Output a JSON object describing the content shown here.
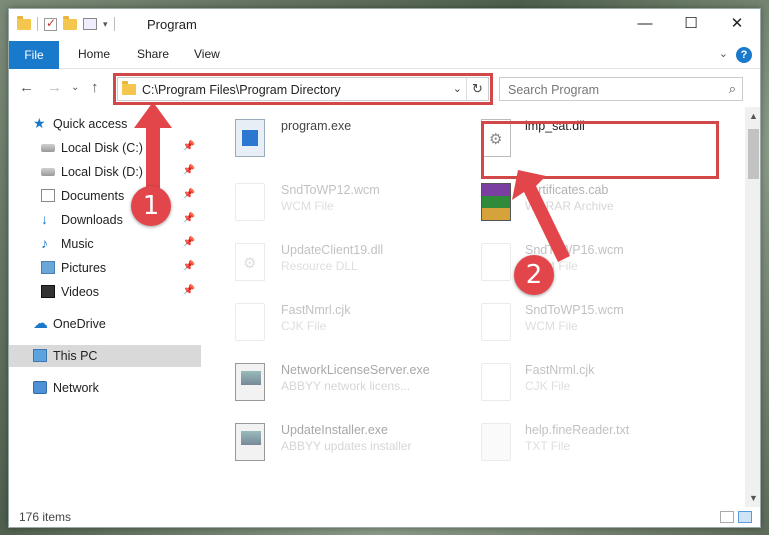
{
  "window": {
    "title": "Program",
    "minimize": "—",
    "maximize": "☐",
    "close": "✕"
  },
  "ribbon": {
    "tabs": [
      "File",
      "Home",
      "Share",
      "View"
    ],
    "help": "?",
    "collapse": "⌄"
  },
  "nav": {
    "back": "←",
    "forward": "→",
    "recent": "⌄",
    "up": "↑",
    "address": "C:\\Program Files\\Program Directory",
    "address_dropdown": "⌄",
    "refresh": "↻",
    "search_placeholder": "Search Program",
    "search_icon": "⌕"
  },
  "sidebar": {
    "items": [
      {
        "label": "Quick access",
        "icon": "star-icon",
        "pinned": false
      },
      {
        "label": "Local Disk (C:)",
        "icon": "drive-icon",
        "pinned": true
      },
      {
        "label": "Local Disk (D:)",
        "icon": "drive-icon",
        "pinned": true
      },
      {
        "label": "Documents",
        "icon": "documents-icon",
        "pinned": true
      },
      {
        "label": "Downloads",
        "icon": "download-icon",
        "pinned": true
      },
      {
        "label": "Music",
        "icon": "music-icon",
        "pinned": true
      },
      {
        "label": "Pictures",
        "icon": "pictures-icon",
        "pinned": true
      },
      {
        "label": "Videos",
        "icon": "videos-icon",
        "pinned": true
      },
      {
        "label": "OneDrive",
        "icon": "cloud-icon",
        "pinned": false
      },
      {
        "label": "This PC",
        "icon": "computer-icon",
        "pinned": false,
        "selected": true
      },
      {
        "label": "Network",
        "icon": "network-icon",
        "pinned": false
      }
    ],
    "pin_glyph": "📌"
  },
  "files": [
    {
      "name": "program.exe",
      "type": "",
      "icon": "exe-icon"
    },
    {
      "name": "imp_sat.dll",
      "type": "",
      "icon": "dll-icon"
    },
    {
      "name": "SndToWP12.wcm",
      "type": "WCM File",
      "icon": "document-icon"
    },
    {
      "name": "certificates.cab",
      "type": "WinRAR Archive",
      "icon": "archive-icon"
    },
    {
      "name": "UpdateClient19.dll",
      "type": "Resource DLL",
      "icon": "dll-icon"
    },
    {
      "name": "SndToWP16.wcm",
      "type": "WCM File",
      "icon": "document-icon"
    },
    {
      "name": "FastNmrl.cjk",
      "type": "CJK File",
      "icon": "document-icon"
    },
    {
      "name": "SndToWP15.wcm",
      "type": "WCM File",
      "icon": "document-icon"
    },
    {
      "name": "NetworkLicenseServer.exe",
      "type": "ABBYY network licens...",
      "icon": "app-icon"
    },
    {
      "name": "FastNrml.cjk",
      "type": "CJK File",
      "icon": "document-icon"
    },
    {
      "name": "UpdateInstaller.exe",
      "type": "ABBYY updates installer",
      "icon": "app-icon"
    },
    {
      "name": "help.fineReader.txt",
      "type": "TXT File",
      "icon": "document-icon"
    }
  ],
  "status": {
    "items_count": "176 items"
  },
  "callouts": {
    "step1": "1",
    "step2": "2"
  },
  "colors": {
    "accent": "#1979ca",
    "highlight": "#d24848"
  }
}
